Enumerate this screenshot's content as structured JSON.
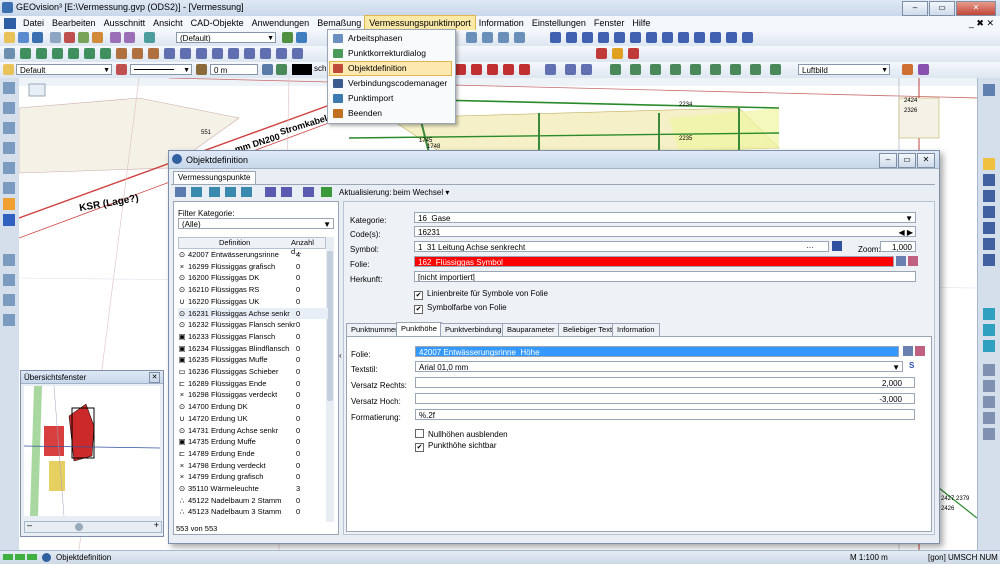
{
  "window": {
    "title": "GEOvision³  [E:\\Vermessung.gvp (ODS2)] - [Vermessung]"
  },
  "menubar": {
    "items": [
      "Datei",
      "Bearbeiten",
      "Ausschnitt",
      "Ansicht",
      "CAD-Objekte",
      "Anwendungen",
      "Bemaßung",
      "Vermessungspunktimport",
      "Information",
      "Einstellungen",
      "Fenster",
      "Hilfe"
    ],
    "right_controls": "_ ✖ ✕"
  },
  "toolbar2": {
    "style_combo": "(Default)"
  },
  "toolbar3": {
    "layer_combo": "Default",
    "distance_value": "0 m",
    "label_text": "sch",
    "raster_combo": "Luftbild"
  },
  "dropdown_menu": {
    "items": [
      "Arbeitsphasen",
      "Punktkorrekturdialog",
      "Objektdefinition",
      "Verbindungscodemanager",
      "Punktimport",
      "Beenden"
    ],
    "highlighted": "Objektdefinition"
  },
  "map": {
    "labels": [
      "KSR (Lage?)",
      "Stromkabel",
      "mm DN200"
    ],
    "numbers": [
      "551",
      "1745",
      "1748",
      "2234",
      "2235",
      "2424",
      "2326",
      "2427 2379",
      "2426"
    ]
  },
  "dialog": {
    "title": "Objektdefinition",
    "top_tab": "Vermessungspunkte",
    "aktualisierung_label": "Aktualisierung:",
    "aktualisierung_value": "beim Wechsel",
    "filter_label": "Filter Kategorie:",
    "filter_value": "(Alle)",
    "columns": [
      "Definition",
      "Anzahl d..."
    ],
    "rows": [
      {
        "icon": "⊙",
        "name": "42007 Entwässerungsrinne",
        "count": "4"
      },
      {
        "icon": "×",
        "name": "16299 Flüssiggas grafisch",
        "count": "0"
      },
      {
        "icon": "⊙",
        "name": "16200 Flüssiggas DK",
        "count": "0"
      },
      {
        "icon": "⊙",
        "name": "16210 Flüssiggas RS",
        "count": "0"
      },
      {
        "icon": "∪",
        "name": "16220 Flüssiggas UK",
        "count": "0"
      },
      {
        "icon": "⊙",
        "name": "16231 Flüssiggas Achse senkr",
        "count": "0"
      },
      {
        "icon": "⊙",
        "name": "16232 Flüssiggas Flansch senkr",
        "count": "0"
      },
      {
        "icon": "▣",
        "name": "16233 Flüssiggas Flansch",
        "count": "0"
      },
      {
        "icon": "▣",
        "name": "16234 Flüssiggas Blindflansch",
        "count": "0"
      },
      {
        "icon": "▣",
        "name": "16235 Flüssiggas Muffe",
        "count": "0"
      },
      {
        "icon": "▭",
        "name": "16236 Flüssiggas Schieber",
        "count": "0"
      },
      {
        "icon": "⊏",
        "name": "16289 Flüssiggas Ende",
        "count": "0"
      },
      {
        "icon": "×",
        "name": "16298 Flüssiggas verdeckt",
        "count": "0"
      },
      {
        "icon": "⊙",
        "name": "14700 Erdung DK",
        "count": "0"
      },
      {
        "icon": "∪",
        "name": "14720 Erdung UK",
        "count": "0"
      },
      {
        "icon": "⊙",
        "name": "14731 Erdung Achse senkr",
        "count": "0"
      },
      {
        "icon": "▣",
        "name": "14735 Erdung Muffe",
        "count": "0"
      },
      {
        "icon": "⊏",
        "name": "14789 Erdung Ende",
        "count": "0"
      },
      {
        "icon": "×",
        "name": "14798 Erdung verdeckt",
        "count": "0"
      },
      {
        "icon": "×",
        "name": "14799 Erdung grafisch",
        "count": "0"
      },
      {
        "icon": "⊙",
        "name": "35110 Wärmeleuchte",
        "count": "3"
      },
      {
        "icon": "∴",
        "name": "45122 Nadelbaum 2 Stamm",
        "count": "0"
      },
      {
        "icon": "∴",
        "name": "45123 Nadelbaum 3 Stamm",
        "count": "0"
      }
    ],
    "list_footer": "553 von 553",
    "kategorie_label": "Kategorie:",
    "kategorie_value": "16_Gase",
    "code_label": "Code(s):",
    "code_value": "16231",
    "symbol_label": "Symbol:",
    "symbol_value": "1_31 Leitung Achse senkrecht",
    "zoom_label": "Zoom:",
    "zoom_value": "1,000",
    "folie_label": "Folie:",
    "folie_value": "162_Flüssiggas Symbol",
    "herkunft_label": "Herkunft:",
    "herkunft_value": "[nicht importiert]",
    "check1": "Linienbreite für Symbole von Folie",
    "check2": "Symbolfarbe von Folie",
    "tabs": [
      "Punktnummer",
      "Punkthöhe",
      "Punktverbindung",
      "Bauparameter",
      "Beliebiger Text",
      "Information"
    ],
    "active_tab": "Punkthöhe",
    "ph_folie_label": "Folie:",
    "ph_folie_value": "42007 Entwässerungsrinne_Höhe",
    "textstil_label": "Textstil:",
    "textstil_value": "Arial 01,0 mm",
    "versatz_rechts_label": "Versatz Rechts:",
    "versatz_rechts_value": "2,000",
    "versatz_hoch_label": "Versatz Hoch:",
    "versatz_hoch_value": "-3,000",
    "format_label": "Formatierung:",
    "format_value": "%.2f",
    "check3": "Nullhöhen ausblenden",
    "check4": "Punkthöhe sichtbar"
  },
  "overview": {
    "title": "Übersichtsfenster"
  },
  "statusbar": {
    "left": "Objektdefinition",
    "scale": "M 1:100  m",
    "right": "[gon]  UMSCH  NUM"
  }
}
